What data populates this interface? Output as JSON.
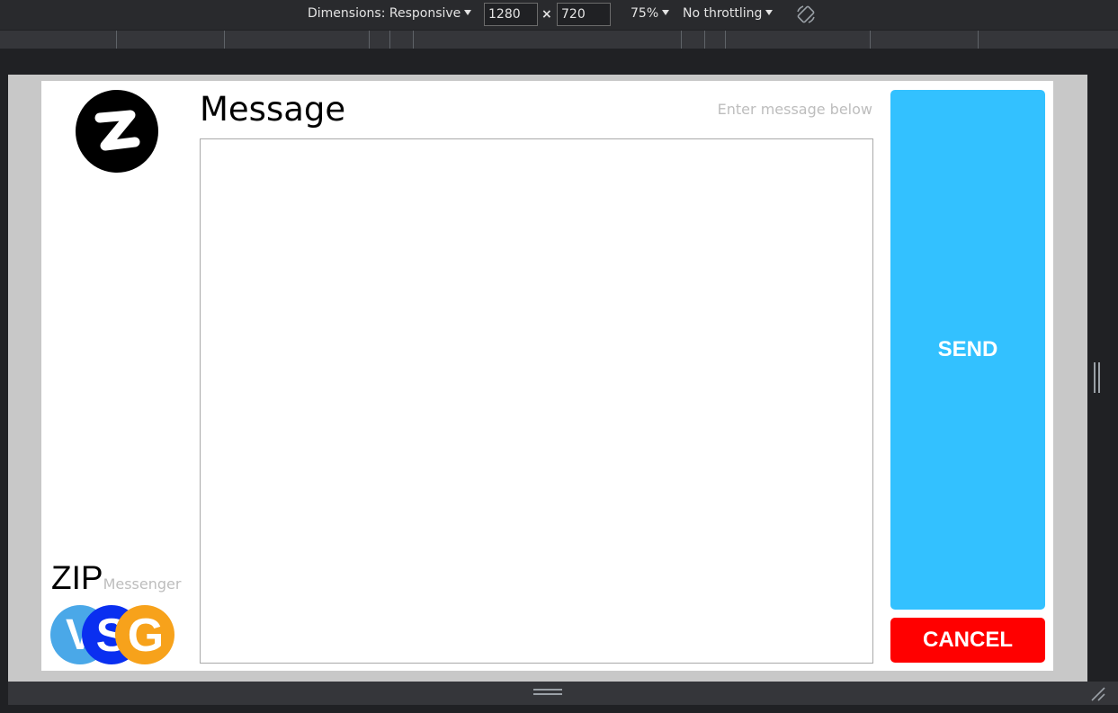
{
  "devtools": {
    "dimensions_label": "Dimensions: Responsive",
    "width_value": "1280",
    "height_value": "720",
    "times_symbol": "×",
    "zoom": "75%",
    "throttling": "No throttling"
  },
  "app": {
    "title": "Message",
    "hint": "Enter message below",
    "message_value": "",
    "send_label": "SEND",
    "cancel_label": "CANCEL",
    "brand_name": "ZIP",
    "brand_sub": "Messenger",
    "logo_letters": "VSG"
  },
  "colors": {
    "send": "#33c1ff",
    "cancel": "#ff0000",
    "hint": "#bdbdbd"
  }
}
